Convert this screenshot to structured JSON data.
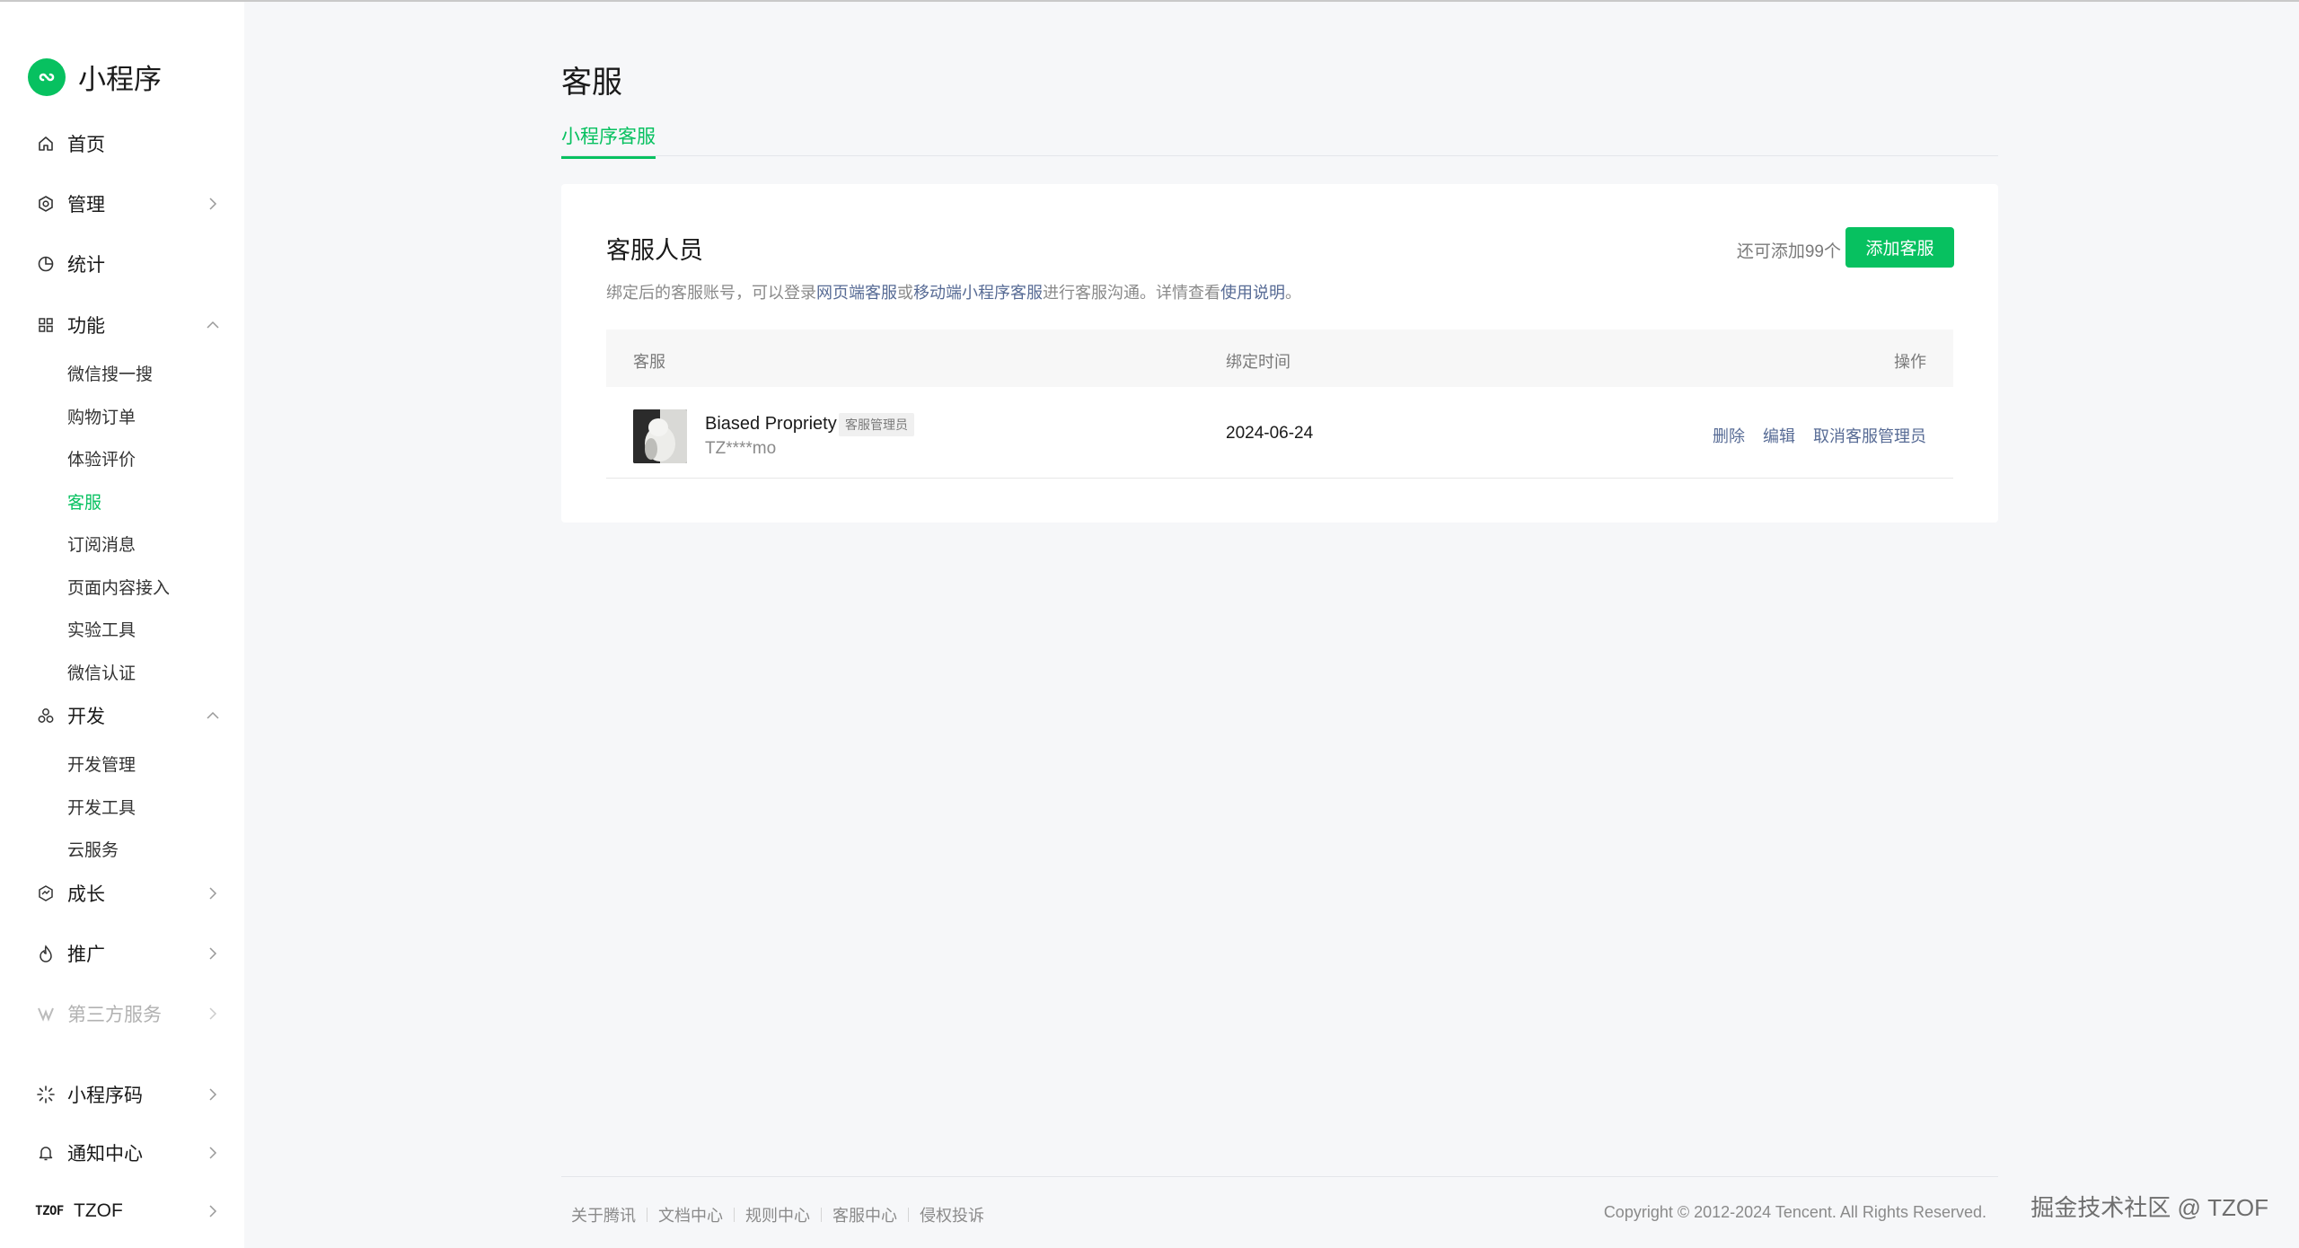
{
  "app": {
    "name": "小程序",
    "brand_color": "#07c160"
  },
  "sidebar": {
    "items": [
      {
        "label": "首页",
        "icon": "home-icon"
      },
      {
        "label": "管理",
        "icon": "gear-icon",
        "chevron": "right"
      },
      {
        "label": "统计",
        "icon": "pie-chart-icon"
      },
      {
        "label": "功能",
        "icon": "grid-icon",
        "chevron": "up",
        "children": [
          "微信搜一搜",
          "购物订单",
          "体验评价",
          "客服",
          "订阅消息",
          "页面内容接入",
          "实验工具",
          "微信认证"
        ]
      },
      {
        "label": "开发",
        "icon": "dev-icon",
        "chevron": "up",
        "children": [
          "开发管理",
          "开发工具",
          "云服务"
        ]
      },
      {
        "label": "成长",
        "icon": "growth-icon",
        "chevron": "right"
      },
      {
        "label": "推广",
        "icon": "promote-icon",
        "chevron": "right"
      },
      {
        "label": "第三方服务",
        "icon": "third-party-icon",
        "chevron": "right",
        "disabled": true
      }
    ],
    "bottom_items": [
      {
        "label": "小程序码",
        "icon": "qrcode-icon"
      },
      {
        "label": "通知中心",
        "icon": "bell-icon"
      },
      {
        "label": "TZOF",
        "icon": "account-logo",
        "logo_text": "TZOF"
      }
    ],
    "active_sub_item": "客服"
  },
  "main": {
    "title": "客服",
    "tabs": [
      {
        "label": "小程序客服",
        "active": true
      }
    ],
    "card": {
      "title": "客服人员",
      "remaining": "还可添加99个",
      "add_button": "添加客服",
      "desc": {
        "prefix": "绑定后的客服账号，可以登录",
        "link1": "网页端客服",
        "mid1": "或",
        "link2": "移动端小程序客服",
        "mid2": "进行客服沟通。详情查看",
        "link3": "使用说明",
        "suffix": "。"
      },
      "table": {
        "columns": [
          "客服",
          "绑定时间",
          "操作"
        ],
        "rows": [
          {
            "name": "Biased Propriety",
            "role_badge": "客服管理员",
            "account": "TZ****mo",
            "bind_time": "2024-06-24",
            "actions": [
              "删除",
              "编辑",
              "取消客服管理员"
            ]
          }
        ]
      }
    }
  },
  "footer": {
    "links": [
      "关于腾讯",
      "文档中心",
      "规则中心",
      "客服中心",
      "侵权投诉"
    ],
    "copyright": "Copyright © 2012-2024 Tencent. All Rights Reserved."
  },
  "watermark": "掘金技术社区 @ TZOF"
}
